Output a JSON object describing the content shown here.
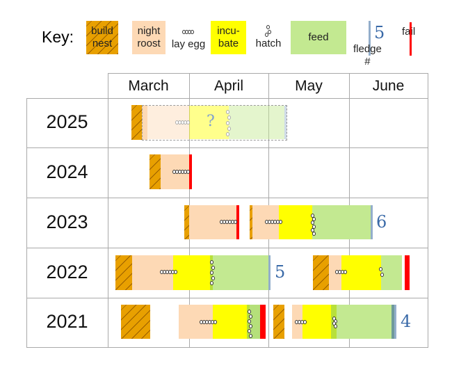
{
  "key": {
    "title": "Key:",
    "build_nest": "build\nnest",
    "night_roost": "night\nroost",
    "lay_egg": "lay egg",
    "incubate": "incu-\nbate",
    "hatch": "hatch",
    "feed": "feed",
    "fledge_example_number": "5",
    "fledge": "fledge #",
    "fail": "fail"
  },
  "colors": {
    "build_nest": "#e8a000",
    "night_roost": "#fdd9b5",
    "incubate": "#ffff00",
    "feed": "#c3e991",
    "fledge": "#93aecb",
    "fail": "#ff0000",
    "fledge_number": "#3a6aa8"
  },
  "months": [
    "March",
    "April",
    "May",
    "June"
  ],
  "years": [
    {
      "year": "2025",
      "unknown_mark": "?",
      "eggs": 5,
      "hatched": 5
    },
    {
      "year": "2024",
      "eggs": 6,
      "outcome": "fail"
    },
    {
      "year": "2023",
      "attempts": [
        {
          "eggs": 6,
          "outcome": "fail"
        },
        {
          "eggs": 6,
          "hatched": 6,
          "fledged": "6"
        }
      ]
    },
    {
      "year": "2022",
      "attempts": [
        {
          "eggs": 6,
          "hatched": 5,
          "fledged": "5"
        },
        {
          "eggs": 4,
          "hatched": 2,
          "outcome": "fail"
        }
      ]
    },
    {
      "year": "2021",
      "attempts": [
        {
          "eggs": 6,
          "hatched": 6,
          "outcome": "fail"
        },
        {
          "eggs": 4,
          "hatched": 4,
          "fledged": "4"
        }
      ]
    }
  ]
}
